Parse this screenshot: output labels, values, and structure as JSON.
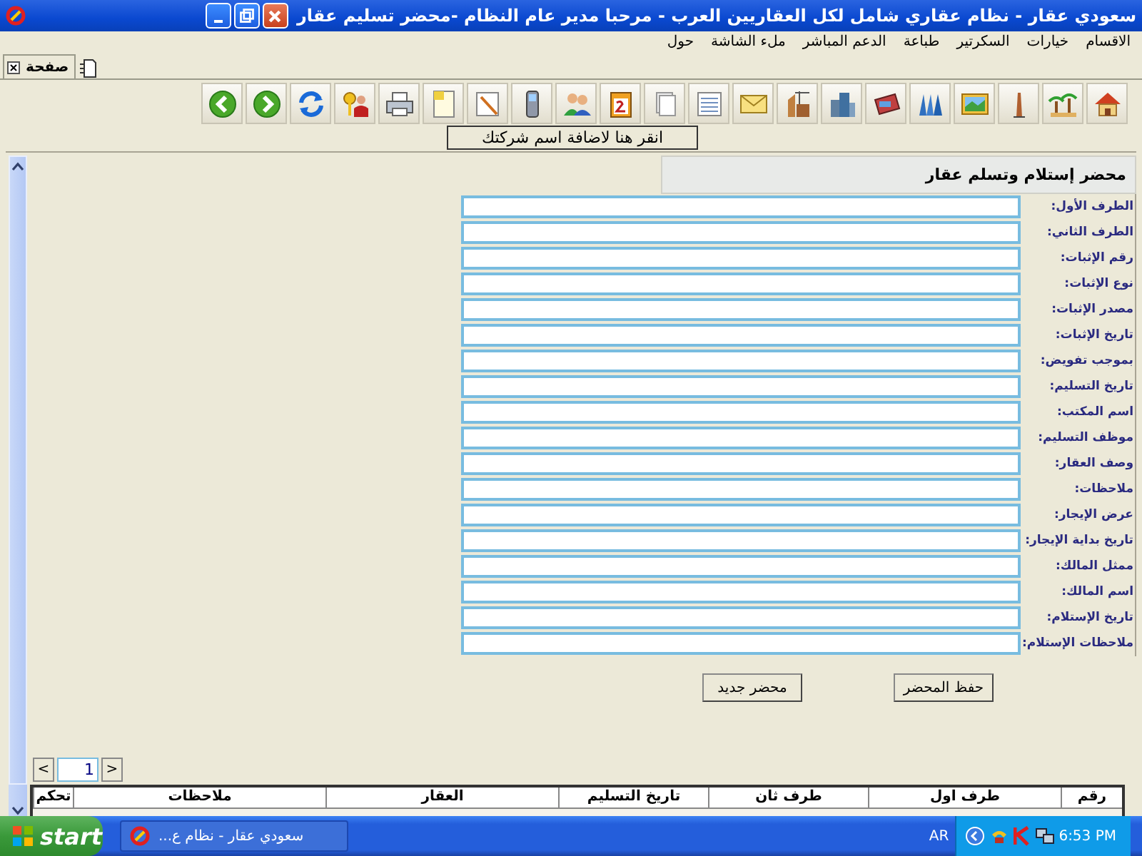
{
  "window": {
    "title": "سعودي عقار - نظام عقاري شامل لكل العقاريين العرب - مرحبا مدير عام النظام -محضر تسليم عقار"
  },
  "menu": [
    "الاقسام",
    "خيارات",
    "السكرتير",
    "طباعة",
    "الدعم المباشر",
    "ملء الشاشة",
    "حول"
  ],
  "tabs": [
    {
      "label": "صفحة",
      "selected": true
    }
  ],
  "company_button": "انقر هنا لاضافة اسم شركتك",
  "form": {
    "title": "محضر إستلام وتسلم عقار",
    "fields": [
      {
        "label": "الطرف الأول:"
      },
      {
        "label": "الطرف الثاني:"
      },
      {
        "label": "رقم الإثبات:"
      },
      {
        "label": "نوع الإثبات:"
      },
      {
        "label": "مصدر الإثبات:"
      },
      {
        "label": "تاريخ الإثبات:"
      },
      {
        "label": "بموجب تفويض:"
      },
      {
        "label": "تاريخ التسليم:"
      },
      {
        "label": "اسم المكتب:"
      },
      {
        "label": "موظف التسليم:"
      },
      {
        "label": "وصف العقار:"
      },
      {
        "label": "ملاحظات:"
      },
      {
        "label": "عرض الإيجار:"
      },
      {
        "label": "تاريخ بداية الإيجار:"
      },
      {
        "label": "ممثل المالك:"
      },
      {
        "label": "اسم المالك:"
      },
      {
        "label": "تاريخ الإستلام:"
      },
      {
        "label": "ملاحظات الإستلام:"
      }
    ],
    "buttons": [
      "حفظ المحضر",
      "محضر جديد"
    ]
  },
  "pager": {
    "prev": "<",
    "page": "1",
    "next": ">"
  },
  "table": {
    "columns": [
      "رقم",
      "طرف اول",
      "طرف ثان",
      "تاريخ التسليم",
      "العقار",
      "ملاحظات",
      "تحكم"
    ]
  },
  "taskbar": {
    "start": "start",
    "task": "سعودي عقار - نظام ع...",
    "language": "AR",
    "time": "6:53 PM"
  }
}
